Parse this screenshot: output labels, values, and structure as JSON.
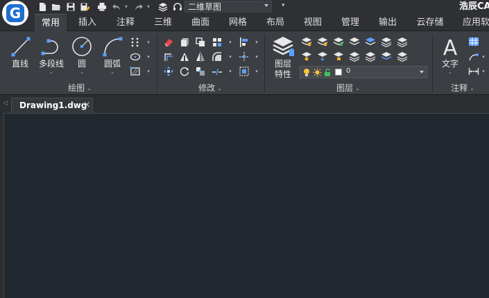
{
  "app": {
    "title": "浩辰CA",
    "logo_letter": "G",
    "brand_color": "#1f6fd0"
  },
  "quick_access": {
    "icons": [
      "new-file-icon",
      "open-folder-icon",
      "save-icon",
      "save-as-icon",
      "print-icon",
      "undo-icon",
      "redo-icon",
      "layers-icon",
      "headset-icon"
    ],
    "workspace": "二维草图"
  },
  "tabs": [
    {
      "label": "常用",
      "active": true
    },
    {
      "label": "插入"
    },
    {
      "label": "注释"
    },
    {
      "label": "三维"
    },
    {
      "label": "曲面"
    },
    {
      "label": "网格"
    },
    {
      "label": "布局"
    },
    {
      "label": "视图"
    },
    {
      "label": "管理"
    },
    {
      "label": "输出"
    },
    {
      "label": "云存储"
    },
    {
      "label": "应用软"
    }
  ],
  "ribbon": {
    "draw": {
      "title": "绘图",
      "buttons": {
        "line": "直线",
        "polyline": "多段线",
        "circle": "圆",
        "arc": "圆弧"
      }
    },
    "modify": {
      "title": "修改"
    },
    "layer": {
      "title": "图层",
      "properties_line1": "图层",
      "properties_line2": "特性",
      "current_layer": "0"
    },
    "annotation": {
      "title": "注释",
      "text": "文字"
    }
  },
  "document": {
    "tab_name": "Drawing1.dwg",
    "close_glyph": "×"
  },
  "canvas": {
    "background": "#212830"
  }
}
